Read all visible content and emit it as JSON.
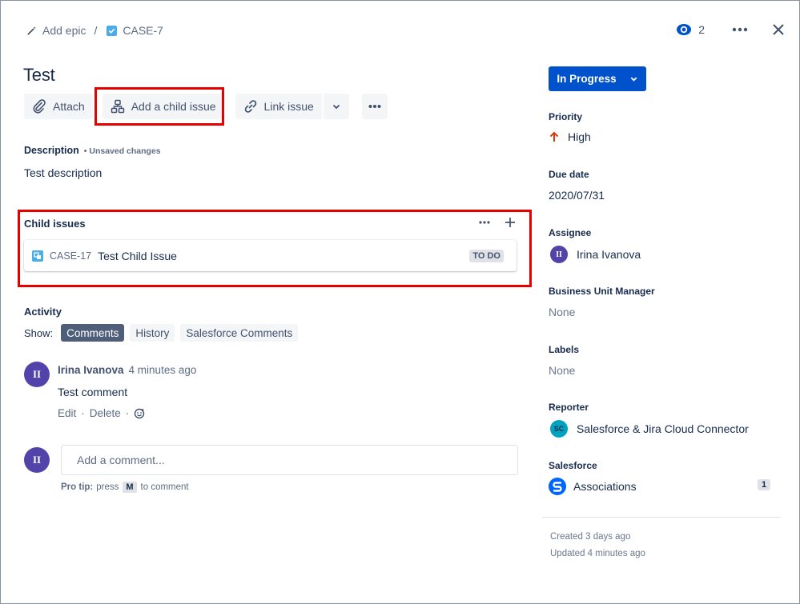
{
  "breadcrumb": {
    "epic_label": "Add epic",
    "separator": "/",
    "issue_key": "CASE-7"
  },
  "header": {
    "watchers_count": "2"
  },
  "issue": {
    "title": "Test"
  },
  "toolbar": {
    "attach_label": "Attach",
    "add_child_label": "Add a child issue",
    "link_label": "Link issue"
  },
  "description": {
    "heading": "Description",
    "unsaved": "• Unsaved changes",
    "text": "Test description"
  },
  "child_issues": {
    "heading": "Child issues",
    "items": [
      {
        "key": "CASE-17",
        "summary": "Test Child Issue",
        "status": "TO DO"
      }
    ]
  },
  "activity": {
    "heading": "Activity",
    "show_label": "Show:",
    "filters": [
      "Comments",
      "History",
      "Salesforce Comments"
    ],
    "active_filter": "Comments",
    "comments": [
      {
        "author": "Irina Ivanova",
        "initials": "II",
        "time": "4 minutes ago",
        "text": "Test comment",
        "edit": "Edit",
        "delete": "Delete"
      }
    ],
    "add_comment_placeholder": "Add a comment...",
    "pro_tip_label": "Pro tip:",
    "pro_tip_pre": "press",
    "pro_tip_key": "M",
    "pro_tip_post": "to comment",
    "current_user_initials": "II"
  },
  "sidebar": {
    "status": "In Progress",
    "priority_label": "Priority",
    "priority_value": "High",
    "due_label": "Due date",
    "due_value": "2020/07/31",
    "assignee_label": "Assignee",
    "assignee_initials": "II",
    "assignee_value": "Irina Ivanova",
    "bum_label": "Business Unit Manager",
    "bum_value": "None",
    "labels_label": "Labels",
    "labels_value": "None",
    "reporter_label": "Reporter",
    "reporter_initials": "SC",
    "reporter_value": "Salesforce & Jira Cloud Connector",
    "salesforce_label": "Salesforce",
    "associations_label": "Associations",
    "associations_count": "1",
    "created": "Created 3 days ago",
    "updated": "Updated 4 minutes ago"
  },
  "colors": {
    "primary": "#0052cc",
    "highlight": "#e60000",
    "avatar": "#5243aa",
    "priority_high": "#de350b"
  }
}
